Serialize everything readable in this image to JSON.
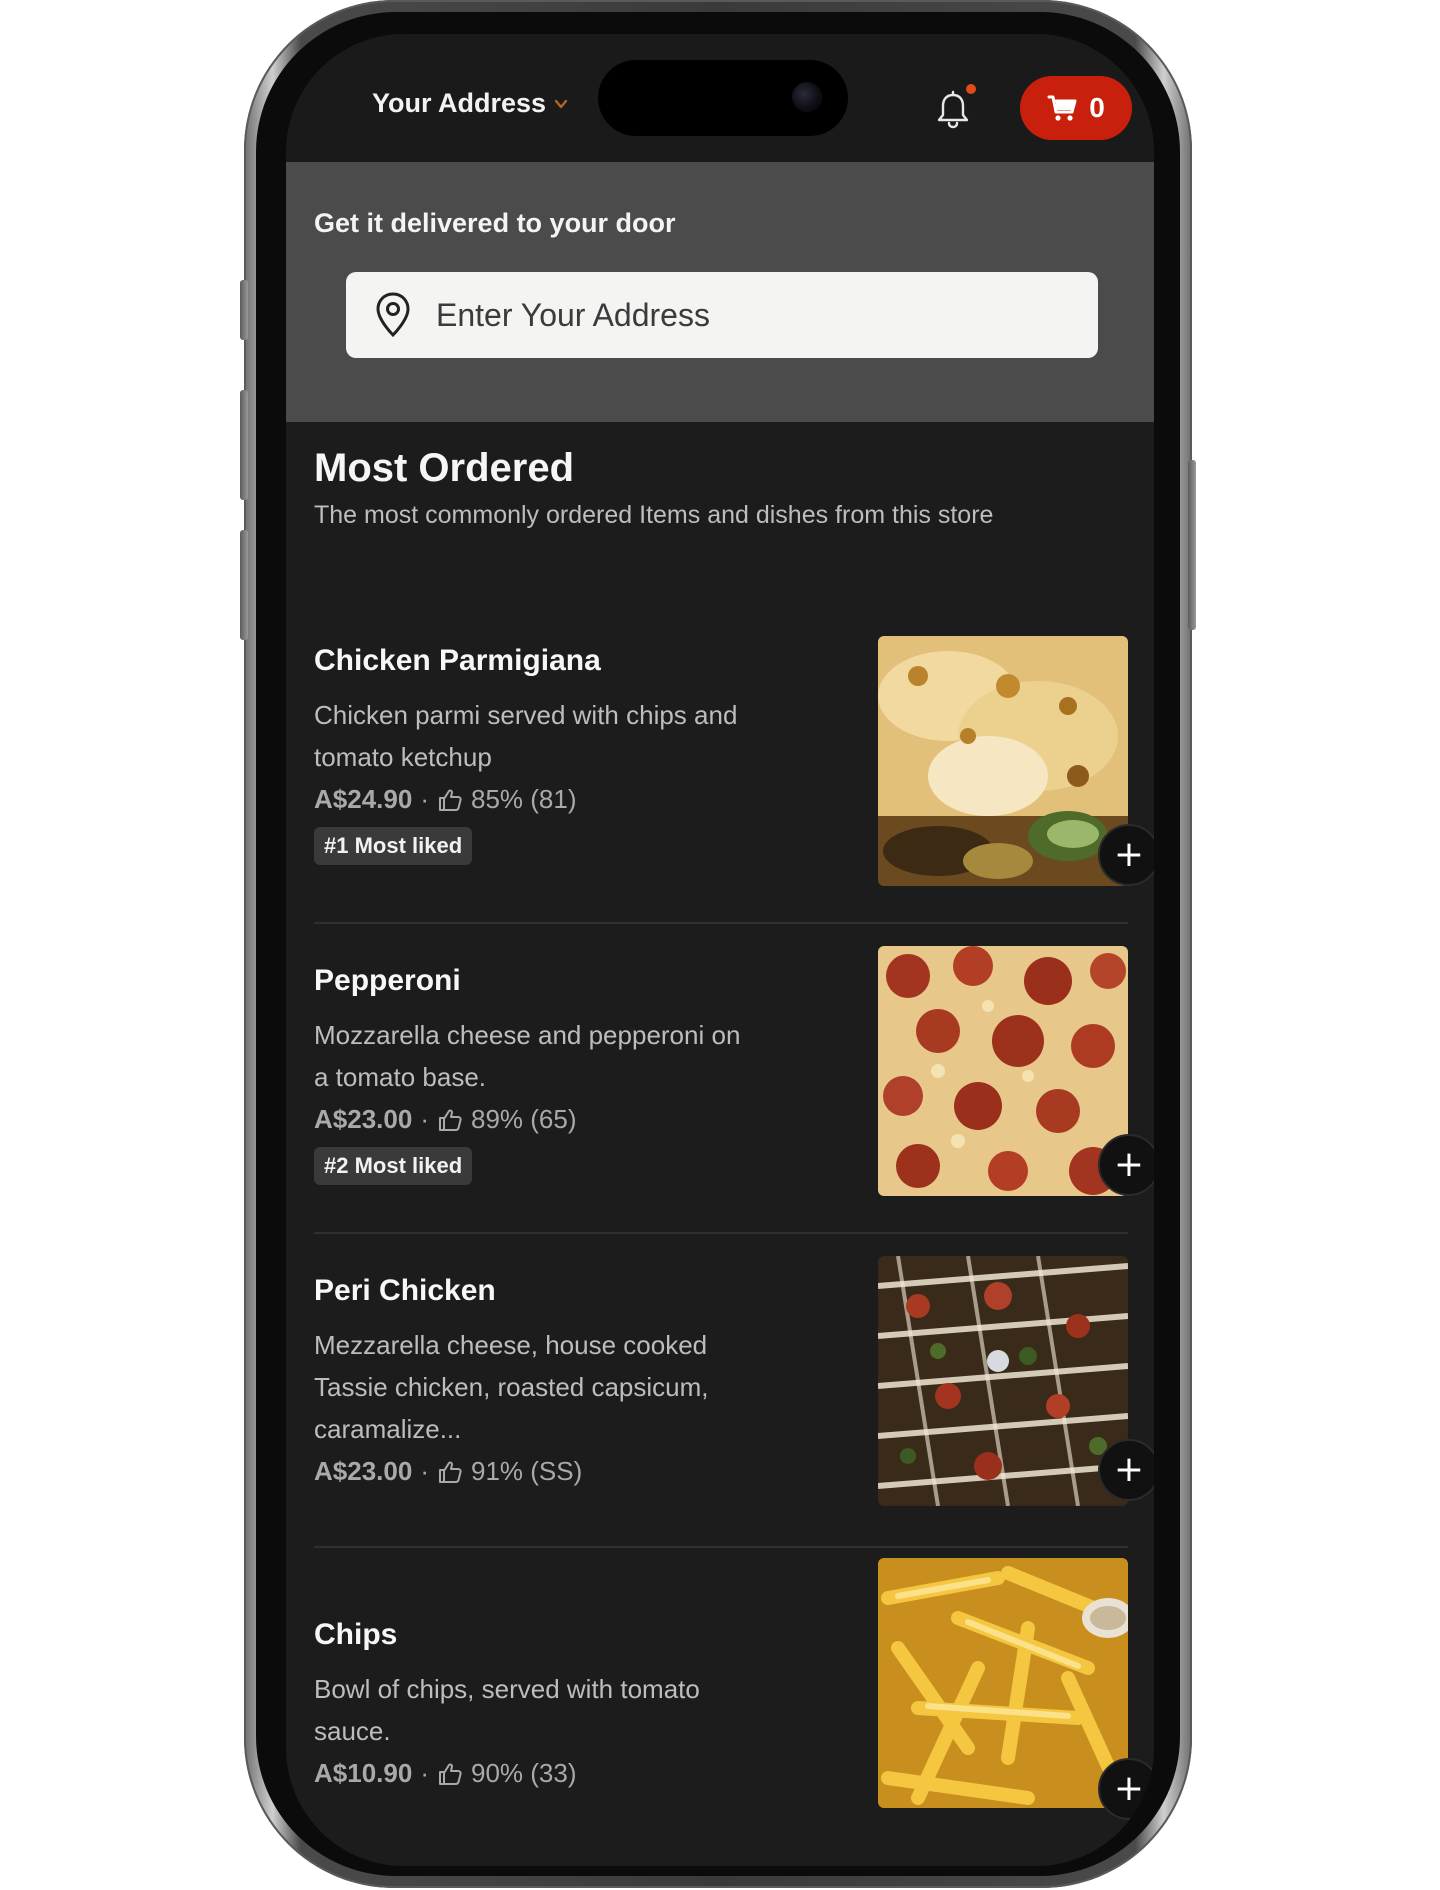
{
  "header": {
    "address_label": "Your Address",
    "cart_count": "0"
  },
  "delivery": {
    "title": "Get it delivered to your door",
    "address_placeholder": "Enter Your Address"
  },
  "most_ordered": {
    "title": "Most Ordered",
    "subtitle": "The most commonly ordered Items and dishes from this store",
    "items": [
      {
        "name": "Chicken Parmigiana",
        "description": "Chicken parmi served with chips and tomato ketchup",
        "price": "A$24.90",
        "rating": "85% (81)",
        "badge": "#1 Most liked"
      },
      {
        "name": "Pepperoni",
        "description": "Mozzarella cheese and pepperoni on a tomato base.",
        "price": "A$23.00",
        "rating": "89% (65)",
        "badge": "#2 Most liked"
      },
      {
        "name": "Peri Chicken",
        "description": "Mezzarella cheese, house cooked Tassie chicken, roasted capsicum, caramalize...",
        "price": "A$23.00",
        "rating": "91% (SS)"
      },
      {
        "name": "Chips",
        "description": "Bowl of chips, served with tomato sauce.",
        "price": "A$10.90",
        "rating": "90% (33)"
      }
    ]
  },
  "separator": "·",
  "add_symbol": "+",
  "colors": {
    "cart_bg": "#c8200c",
    "screen_bg": "#1c1c1c",
    "delivery_bg": "#4b4b4b"
  },
  "icons": [
    "chevron-down-icon",
    "bell-icon",
    "cart-icon",
    "location-pin-icon",
    "thumbs-up-icon",
    "plus-icon"
  ]
}
